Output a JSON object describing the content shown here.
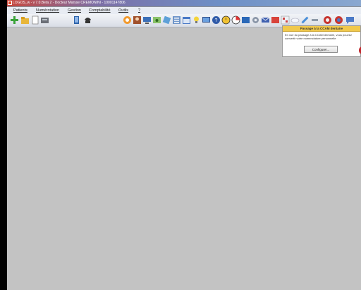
{
  "window": {
    "title": "LOGOS_w - v 7.0.Beta 2 - Docteur Maryse CREMONINI - 10001147806"
  },
  "menu": [
    {
      "label": "Patients"
    },
    {
      "label": "Numérotation"
    },
    {
      "label": "Gestion"
    },
    {
      "label": "Comptabilité"
    },
    {
      "label": "Outils"
    },
    {
      "label": "?"
    }
  ],
  "toolbar": {
    "icons": [
      "add-patient-icon",
      "open-folder-icon",
      "document-icon",
      "card-reader-icon",
      "tablet-icon",
      "phone-icon",
      "lifebuoy-icon",
      "portrait-icon",
      "monitor-icon",
      "music-icon",
      "link-icon",
      "list-icon",
      "calendar-icon",
      "lightbulb-icon",
      "computer-icon",
      "help-icon",
      "clock-icon",
      "chart-icon",
      "book-icon",
      "settings-icon",
      "mail-icon",
      "folder-icon",
      "grid-icon",
      "cloud-icon",
      "pencil-icon",
      "tools-icon",
      "shield-icon",
      "chat-icon"
    ]
  },
  "notification": {
    "title": "Passage à la CCAM dentaire",
    "body": "En vue du passage à la CCAM dentaire, vous pouvez convertir votre nomenclature personnelle",
    "button_label": "Configurer..."
  },
  "colors": {
    "workspace": "#c3c3c3",
    "popup_header": "#f0c84b",
    "accent_red": "#c0272d"
  }
}
